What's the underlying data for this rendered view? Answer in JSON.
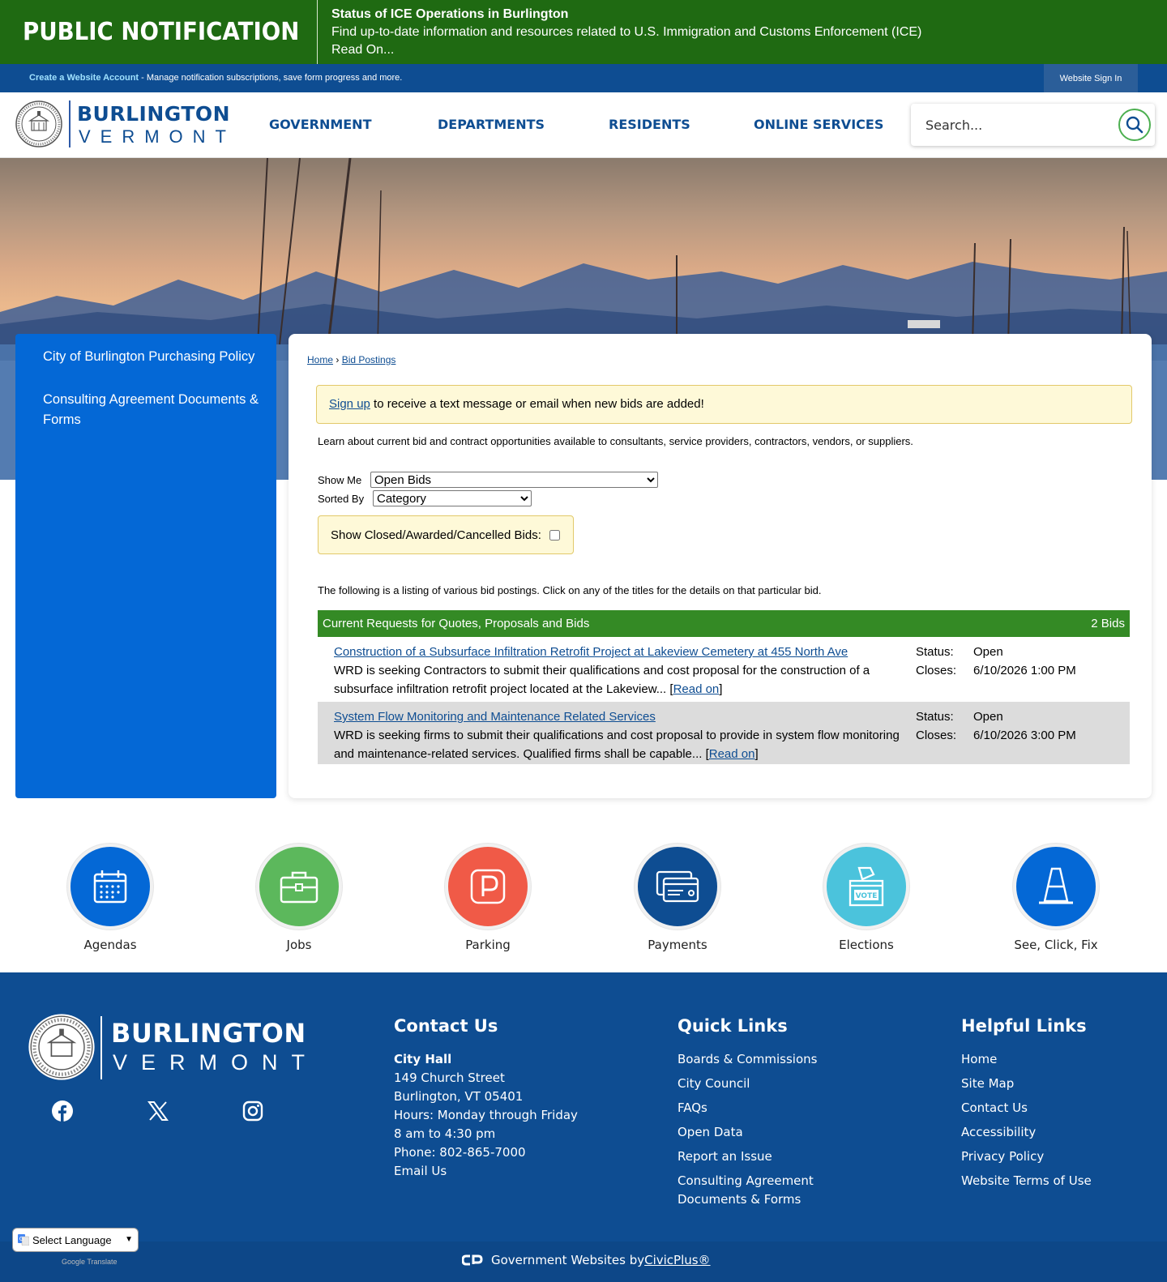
{
  "alert": {
    "brand": "PUBLIC NOTIFICATION",
    "title": "Status of ICE Operations in Burlington",
    "message": "Find up-to-date information and resources related to U.S. Immigration and Customs Enforcement (ICE)",
    "read_on": "Read On..."
  },
  "account_bar": {
    "create_link": "Create a Website Account",
    "create_desc": " - Manage notification subscriptions, save form progress and more.",
    "sign_in": "Website Sign In"
  },
  "header": {
    "logo_line1": "BURLINGTON",
    "logo_line2": "VERMONT",
    "nav": [
      "GOVERNMENT",
      "DEPARTMENTS",
      "RESIDENTS",
      "ONLINE SERVICES"
    ],
    "search_placeholder": "Search..."
  },
  "sidebar": {
    "items": [
      {
        "label": "City of Burlington Purchasing Policy"
      },
      {
        "label": "Consulting Agreement Documents & Forms"
      }
    ]
  },
  "main": {
    "breadcrumb": {
      "home": "Home",
      "sep": "›",
      "current": "Bid Postings"
    },
    "notice": {
      "link": "Sign up",
      "text": " to receive a text message or email when new bids are added!"
    },
    "intro": "Learn about current bid and contract opportunities available to consultants, service providers, contractors, vendors, or suppliers.",
    "show_me_label": "Show Me",
    "show_me_value": "Open Bids",
    "sorted_by_label": "Sorted By",
    "sorted_by_value": "Category",
    "closed_label": "Show Closed/Awarded/Cancelled Bids:",
    "listing_text": "The following is a listing of various bid postings. Click on any of the titles for the details on that particular bid.",
    "table": {
      "title": "Current Requests for Quotes, Proposals and Bids",
      "count": "2 Bids",
      "status_key": "Status:",
      "closes_key": "Closes:",
      "read_on": "Read on",
      "rows": [
        {
          "title": "Construction of a Subsurface Infiltration Retrofit Project at Lakeview Cemetery at 455 North Ave",
          "desc": "WRD is seeking Contractors to submit their qualifications and cost proposal for the construction of a subsurface infiltration retrofit project located at the Lakeview... ",
          "status": "Open",
          "closes": "6/10/2026 1:00 PM"
        },
        {
          "title": "System Flow Monitoring and Maintenance Related Services",
          "desc": "WRD is seeking firms to submit their qualifications and cost proposal to provide in system flow monitoring and maintenance-related services. Qualified firms shall be capable... ",
          "status": "Open",
          "closes": "6/10/2026 3:00 PM"
        }
      ]
    }
  },
  "quick_links": [
    {
      "label": "Agendas",
      "icon": "calendar-icon",
      "color": "#0468d6"
    },
    {
      "label": "Jobs",
      "icon": "briefcase-icon",
      "color": "#5cb85c"
    },
    {
      "label": "Parking",
      "icon": "parking-icon",
      "color": "#f05a47"
    },
    {
      "label": "Payments",
      "icon": "credit-card-icon",
      "color": "#0e4d92"
    },
    {
      "label": "Elections",
      "icon": "ballot-box-icon",
      "color": "#4bc3dc"
    },
    {
      "label": "See, Click, Fix",
      "icon": "traffic-cone-icon",
      "color": "#0468d6"
    }
  ],
  "footer": {
    "logo_line1": "BURLINGTON",
    "logo_line2": "VERMONT",
    "contact": {
      "heading": "Contact Us",
      "name": "City Hall",
      "street": "149 Church Street",
      "city": "Burlington, VT 05401",
      "hours1": "Hours: Monday through Friday",
      "hours2": "8 am to 4:30 pm",
      "phone": "Phone: 802-865-7000",
      "email": "Email Us"
    },
    "quick_links": {
      "heading": "Quick Links",
      "items": [
        "Boards & Commissions",
        "City Council",
        "FAQs",
        "Open Data",
        "Report an Issue",
        "Consulting Agreement Documents & Forms"
      ]
    },
    "helpful_links": {
      "heading": "Helpful Links",
      "items": [
        "Home",
        "Site Map",
        "Contact Us",
        "Accessibility",
        "Privacy Policy",
        "Website Terms of Use"
      ]
    }
  },
  "bottom": {
    "text": "Government Websites by ",
    "brand": "CivicPlus®",
    "language": "Select Language",
    "powered": "Google Translate"
  }
}
